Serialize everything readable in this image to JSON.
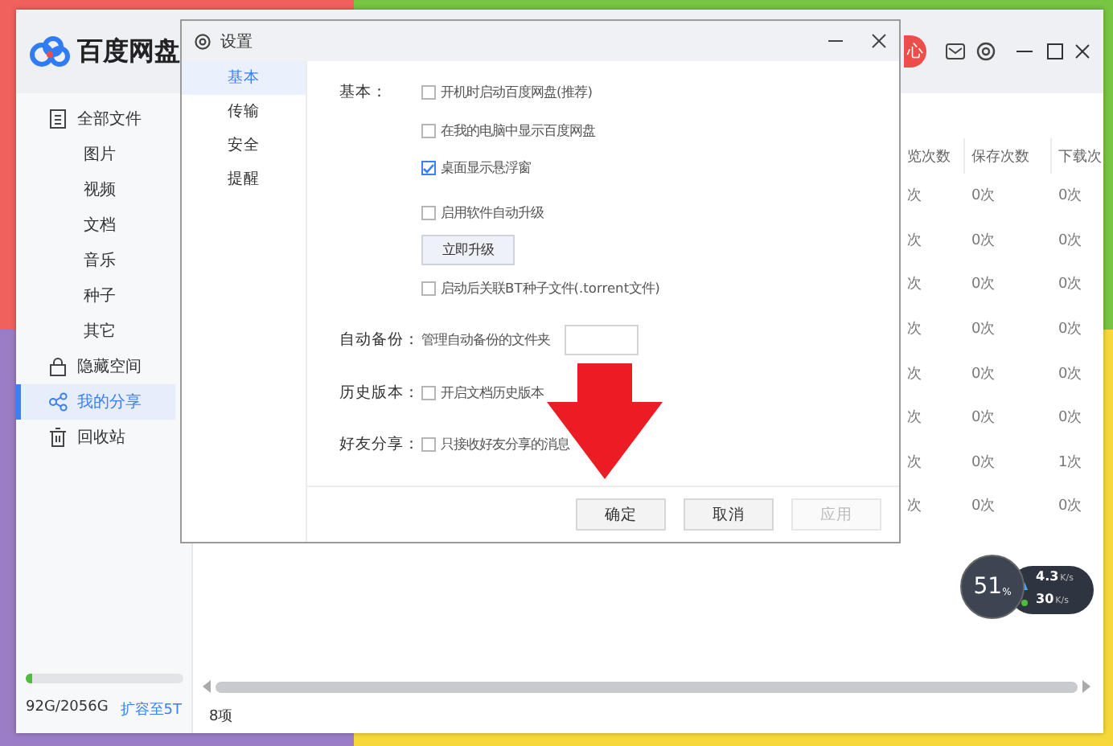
{
  "app": {
    "logo_text": "百度网盘",
    "header_button": "心",
    "sidebar": {
      "items": [
        {
          "label": "全部文件",
          "selected": false,
          "children": [
            {
              "label": "图片",
              "selected": false
            },
            {
              "label": "视频",
              "selected": false
            },
            {
              "label": "文档",
              "selected": false
            },
            {
              "label": "音乐",
              "selected": false
            },
            {
              "label": "种子",
              "selected": false
            },
            {
              "label": "其它",
              "selected": false
            }
          ]
        },
        {
          "label": "隐藏空间",
          "selected": false
        },
        {
          "label": "我的分享",
          "selected": true
        },
        {
          "label": "回收站",
          "selected": false
        }
      ],
      "storage": {
        "level": 0.045,
        "usage": "92G/2056G",
        "upgrade_link": "扩容至5T"
      }
    },
    "table": {
      "columns": [
        "览次数",
        "保存次数",
        "下载次"
      ],
      "rows": [
        [
          "次",
          "0次",
          "0次"
        ],
        [
          "次",
          "0次",
          "0次"
        ],
        [
          "次",
          "0次",
          "0次"
        ],
        [
          "次",
          "0次",
          "0次"
        ],
        [
          "次",
          "0次",
          "0次"
        ],
        [
          "次",
          "0次",
          "0次"
        ],
        [
          "次",
          "0次",
          "1次"
        ],
        [
          "次",
          "0次",
          "0次"
        ]
      ]
    },
    "status_bar": "8项"
  },
  "dialog": {
    "title": "设置",
    "tabs": [
      {
        "label": "基本",
        "selected": true
      },
      {
        "label": "传输",
        "selected": false
      },
      {
        "label": "安全",
        "selected": false
      },
      {
        "label": "提醒",
        "selected": false
      }
    ],
    "sections": [
      {
        "label": "基本：",
        "items": [
          {
            "kind": "checkbox",
            "label": "开机时启动百度网盘(推荐)",
            "checked": false
          },
          {
            "kind": "checkbox",
            "label": "在我的电脑中显示百度网盘",
            "checked": false
          },
          {
            "kind": "checkbox",
            "label": "桌面显示悬浮窗",
            "checked": true
          },
          {
            "kind": "checkbox",
            "label": "启用软件自动升级",
            "checked": false
          },
          {
            "kind": "button",
            "label": "立即升级"
          },
          {
            "kind": "checkbox",
            "label": "启动后关联BT种子文件(.torrent文件)",
            "checked": false
          }
        ]
      },
      {
        "label": "自动备份：",
        "items": [
          {
            "kind": "text",
            "label": "管理自动备份的文件夹"
          }
        ]
      },
      {
        "label": "历史版本：",
        "items": [
          {
            "kind": "checkbox",
            "label": "开启文档历史版本",
            "checked": false
          }
        ]
      },
      {
        "label": "好友分享：",
        "items": [
          {
            "kind": "checkbox",
            "label": "只接收好友分享的消息",
            "checked": false
          }
        ]
      }
    ],
    "buttons": [
      {
        "label": "确定",
        "disabled": false
      },
      {
        "label": "取消",
        "disabled": false
      },
      {
        "label": "应用",
        "disabled": true
      }
    ]
  },
  "speed_widget": {
    "percent": "51",
    "percent_unit": "%",
    "upload": "4.3",
    "upload_unit": "K/s",
    "download": "30",
    "download_unit": "K/s"
  }
}
